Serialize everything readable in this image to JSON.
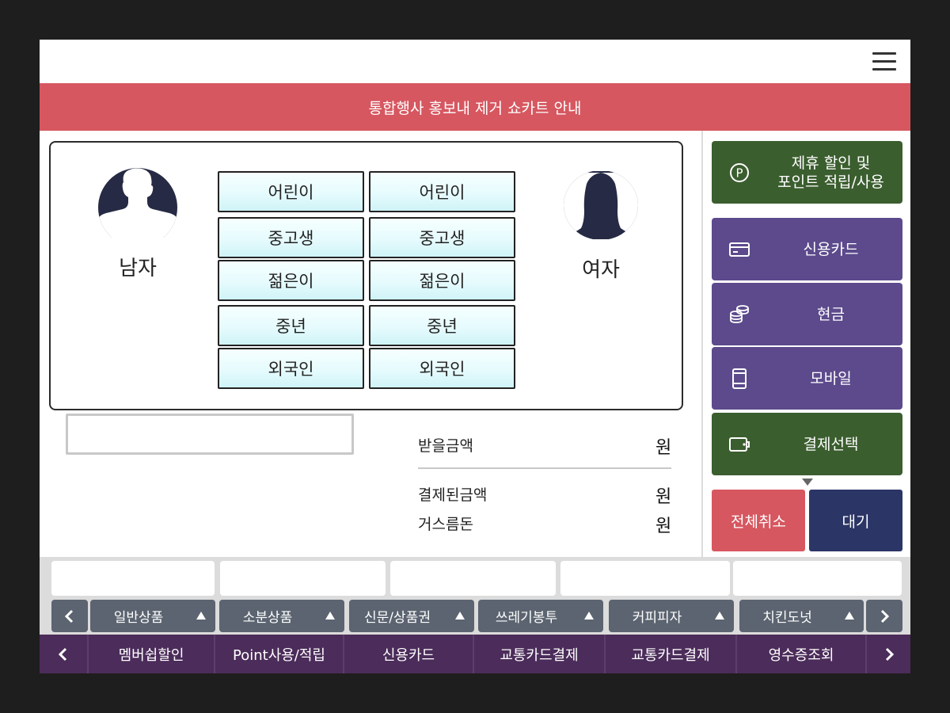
{
  "notice": {
    "text": "통합행사 홍보내 제거 쇼카트 안내"
  },
  "customer": {
    "male_label": "남자",
    "female_label": "여자",
    "male_buttons": [
      "어린이",
      "중고생",
      "젊은이",
      "중년",
      "외국인"
    ],
    "female_buttons": [
      "어린이",
      "중고생",
      "젊은이",
      "중년",
      "외국인"
    ]
  },
  "amounts": {
    "receivable_label": "받을금액",
    "paid_label": "결제된금액",
    "change_label": "거스름돈",
    "unit": "원"
  },
  "payment": {
    "partner_line1": "제휴 할인 및",
    "partner_line2": "포인트 적립/사용",
    "credit_card": "신용카드",
    "cash": "현금",
    "mobile": "모바일",
    "select": "결제선택",
    "cancel_all": "전체취소",
    "wait": "대기"
  },
  "categories": [
    "일반상품",
    "소분상품",
    "신문/상품권",
    "쓰레기봉투",
    "커피피자",
    "치킨도넛"
  ],
  "bottom_menu": [
    "멤버쉽할인",
    "Point사용/적립",
    "신용카드",
    "교통카드결제",
    "교통카드결제",
    "영수증조회"
  ],
  "colors": {
    "notice_bg": "#d65760",
    "green": "#3b5e2f",
    "purple": "#5c4a8c",
    "cancel": "#d65760",
    "wait": "#2b3566",
    "bottom_bar": "#4b2c5a",
    "category": "#5b6470"
  },
  "icons": {
    "menu": "hamburger-icon",
    "partner": "point-p-icon",
    "credit_card": "credit-card-icon",
    "cash": "coins-icon",
    "mobile": "mobile-phone-icon",
    "select": "wallet-icon",
    "male": "male-avatar-icon",
    "female": "female-avatar-icon"
  }
}
